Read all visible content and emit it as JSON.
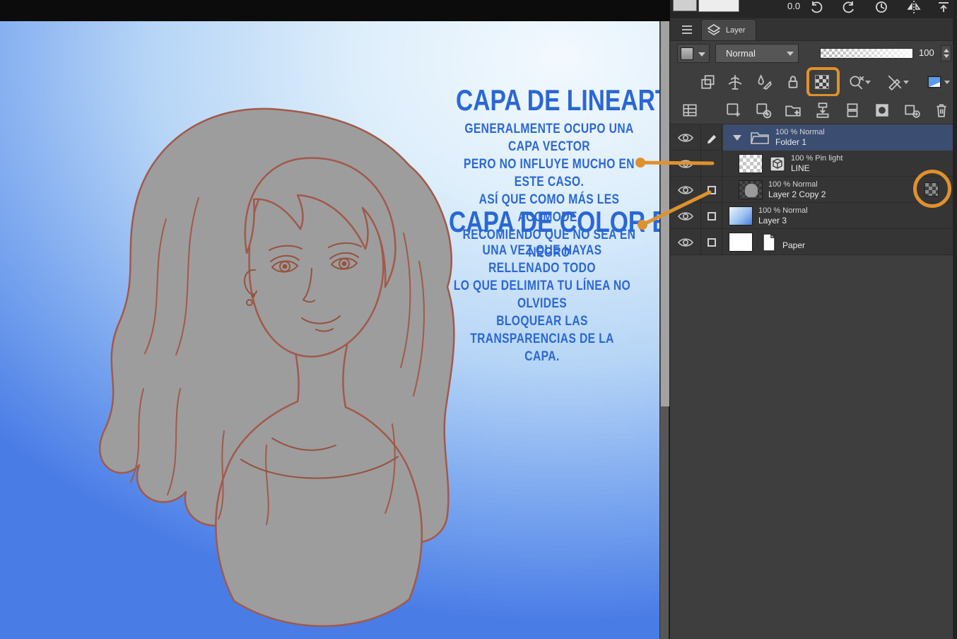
{
  "canvas": {
    "annotations": {
      "lineart": {
        "title": "CAPA DE LINEART",
        "lines": [
          "GENERALMENTE OCUPO UNA CAPA VECTOR",
          "PERO NO INFLUYE MUCHO EN ESTE CASO.",
          "ASÍ QUE COMO MÁS LES ACOMODE.",
          "RECOMIENDO QUE NO SEA EN NEGRO"
        ]
      },
      "color_base": {
        "title": "CAPA DE COLOR BASE",
        "lines": [
          "UNA VEZ QUE HAYAS RELLENADO TODO",
          "LO QUE DELIMITA TU LÍNEA NO OLVIDES",
          "BLOQUEAR LAS TRANSPARENCIAS DE LA",
          "CAPA."
        ]
      }
    }
  },
  "top_toolbar": {
    "rotation_value": "0.0"
  },
  "layer_panel": {
    "tab": "Layer",
    "blend_mode": "Normal",
    "opacity": "100",
    "layers": [
      {
        "kind": "folder",
        "blend": "100 % Normal",
        "name": "Folder 1",
        "selected": true
      },
      {
        "kind": "vector",
        "blend": "100 % Pin light",
        "name": "LINE"
      },
      {
        "kind": "raster",
        "blend": "100 % Normal",
        "name": "Layer 2 Copy 2",
        "alpha_locked": true
      },
      {
        "kind": "raster",
        "blend": "100 % Normal",
        "name": "Layer 3"
      },
      {
        "kind": "paper",
        "name": "Paper"
      }
    ]
  },
  "icons": {
    "top_strip": [
      "rotate-left-icon",
      "rotate-right-icon",
      "reset-rotation-icon",
      "flip-horizontal-icon",
      "fit-to-screen-icon"
    ],
    "tab_row": [
      "menu-icon",
      "layers-stack-icon"
    ],
    "toolbar_row1": [
      "clip-at-layer-below-icon",
      "reference-layer-icon",
      "draft-layer-icon",
      "lock-layer-icon",
      "lock-transparent-pixels-icon",
      "enable-mask-icon",
      "ruler-range-icon",
      "layer-color-icon"
    ],
    "toolbar_row2": [
      "palette-grid-icon",
      "new-raster-layer-icon",
      "new-layer-dialog-icon",
      "new-folder-icon",
      "transfer-down-icon",
      "merge-down-icon",
      "create-mask-icon",
      "apply-mask-icon",
      "delete-layer-icon"
    ],
    "rows": [
      "eye-icon",
      "pen-icon",
      "folder-icon",
      "vector-cube-icon",
      "paper-icon",
      "alpha-lock-badge-icon"
    ]
  },
  "colors": {
    "annotation_blue": "#2b67d4",
    "annotation_orange": "#df912d",
    "selected_row_blue": "#3b4d70",
    "canvas_deep_blue": "#4a7ce6"
  }
}
